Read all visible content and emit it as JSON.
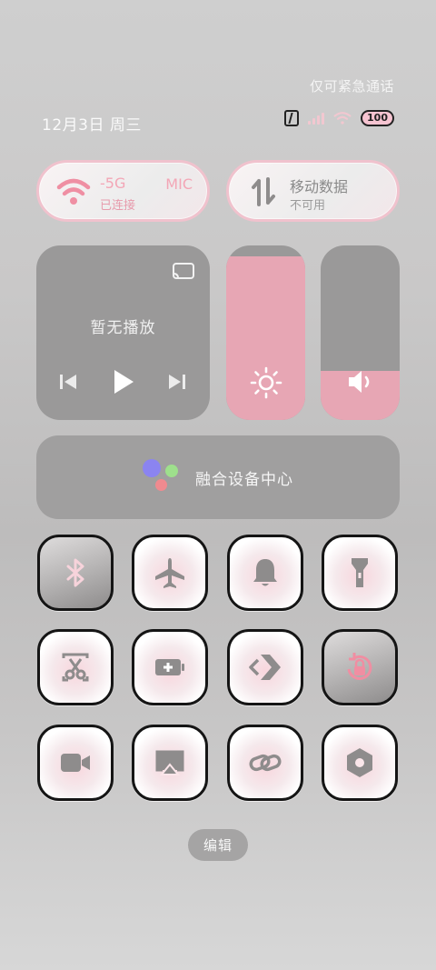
{
  "status_bar": {
    "emergency_text": "仅可紧急通话",
    "date": "12月3日 周三",
    "battery": "100"
  },
  "wifi_pill": {
    "name": "-5G",
    "status": "已连接",
    "extra": "MIC"
  },
  "mobile_pill": {
    "title": "移动数据",
    "status": "不可用"
  },
  "media": {
    "now_playing": "暂无播放"
  },
  "sliders": {
    "brightness_level": 0.94,
    "volume_level": 0.28
  },
  "fusion": {
    "label": "融合设备中心"
  },
  "toggles": [
    {
      "name": "bluetooth-icon"
    },
    {
      "name": "airplane-icon"
    },
    {
      "name": "bell-icon"
    },
    {
      "name": "flashlight-icon"
    },
    {
      "name": "screenshot-icon"
    },
    {
      "name": "battery-saver-icon"
    },
    {
      "name": "nearby-share-icon"
    },
    {
      "name": "rotation-lock-icon"
    },
    {
      "name": "screen-record-icon"
    },
    {
      "name": "screen-cast-icon"
    },
    {
      "name": "link-icon"
    },
    {
      "name": "settings-icon"
    }
  ],
  "edit_button": {
    "label": "编辑"
  },
  "colors": {
    "accent_pink": "#e7a6b4",
    "panel_gray": "#9a9999",
    "tile_icon": "#8e8c8c"
  }
}
